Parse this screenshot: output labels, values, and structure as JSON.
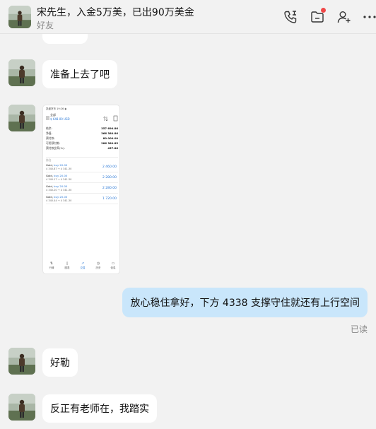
{
  "header": {
    "title": "宋先生，入金5万美，已出90万美金",
    "subtitle": "好友",
    "icons": [
      "call-icon",
      "folder-icon",
      "add-friend-icon",
      "more-icon"
    ],
    "notification_dot_color": "#f04848"
  },
  "messages": [
    {
      "from": "other",
      "type": "text",
      "text": "准备上去了吧"
    },
    {
      "from": "other",
      "type": "image",
      "screenshot": {
        "status_time": "凯盛货币  19:26 ◉",
        "account_name": "全部",
        "account_balance": "$ 648.00 USD",
        "summary": [
          {
            "label": "结余:",
            "value": "357 690.86"
          },
          {
            "label": "净值:",
            "value": "366 380.86"
          },
          {
            "label": "预付款:",
            "value": "80 000.00"
          },
          {
            "label": "可用预付款:",
            "value": "286 380.85"
          },
          {
            "label": "预付款比率(%):",
            "value": "457.86"
          }
        ],
        "section_label": "持仓",
        "positions": [
          {
            "symbol": "Gold,",
            "side": "buy 20.00",
            "prices": "4 340.87 → 4 341.30",
            "profit": "2 460.00"
          },
          {
            "symbol": "Gold,",
            "side": "buy 20.00",
            "prices": "4 340.17 → 4 341.30",
            "profit": "2 280.00"
          },
          {
            "symbol": "Gold,",
            "side": "buy 20.00",
            "prices": "4 340.20 → 4 341.30",
            "profit": "2 280.00"
          },
          {
            "symbol": "Gold,",
            "side": "buy 20.00",
            "prices": "4 340.44 → 4 341.30",
            "profit": "1 720.00"
          }
        ],
        "nav": [
          "行情",
          "图表",
          "交易",
          "历史",
          "信息"
        ]
      }
    },
    {
      "from": "me",
      "type": "text",
      "text": "放心稳住拿好，下方 4338 支撑守住就还有上行空间",
      "status": "已读"
    },
    {
      "from": "other",
      "type": "text",
      "text": "好勒"
    },
    {
      "from": "other",
      "type": "text",
      "text": "反正有老师在，我踏实"
    }
  ],
  "colors": {
    "background": "#f2f2f2",
    "incoming_bubble": "#ffffff",
    "outgoing_bubble": "#c9e6fb",
    "accent_blue": "#2a78d6"
  }
}
